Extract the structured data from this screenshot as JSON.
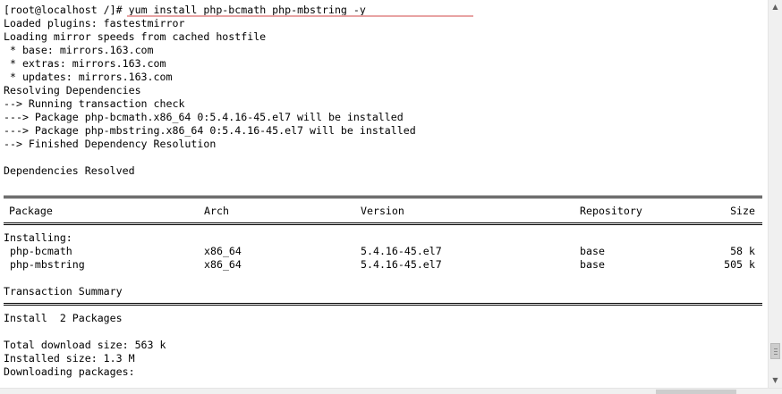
{
  "terminal": {
    "prompt": "[root@localhost /]# ",
    "command": "yum install php-bcmath php-mbstring -y",
    "pre_lines": [
      "Loaded plugins: fastestmirror",
      "Loading mirror speeds from cached hostfile",
      " * base: mirrors.163.com",
      " * extras: mirrors.163.com",
      " * updates: mirrors.163.com",
      "Resolving Dependencies",
      "--> Running transaction check",
      "---> Package php-bcmath.x86_64 0:5.4.16-45.el7 will be installed",
      "---> Package php-mbstring.x86_64 0:5.4.16-45.el7 will be installed",
      "--> Finished Dependency Resolution",
      "",
      "Dependencies Resolved"
    ],
    "table": {
      "headers": [
        "Package",
        "Arch",
        "Version",
        "Repository",
        "Size"
      ],
      "section_label": "Installing:",
      "rows": [
        [
          " php-bcmath",
          "x86_64",
          "5.4.16-45.el7",
          "base",
          "58 k"
        ],
        [
          " php-mbstring",
          "x86_64",
          "5.4.16-45.el7",
          "base",
          "505 k"
        ]
      ]
    },
    "summary_title": "Transaction Summary",
    "install_line": "Install  2 Packages",
    "post_lines": [
      "",
      "Total download size: 563 k",
      "Installed size: 1.3 M",
      "Downloading packages:"
    ]
  },
  "scrollbars": {
    "up_icon": "arrow-up-icon",
    "down_icon": "arrow-down-icon"
  }
}
